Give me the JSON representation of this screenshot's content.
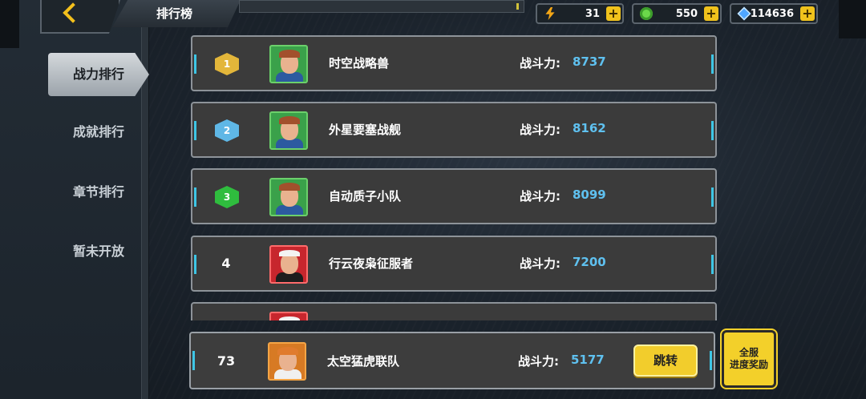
{
  "header": {
    "title": "排行榜"
  },
  "resources": [
    {
      "icon": "energy-bolt-icon",
      "value": "31"
    },
    {
      "icon": "green-gem-icon",
      "value": "550"
    },
    {
      "icon": "diamond-icon",
      "value": "114636"
    }
  ],
  "tabs": [
    "战力排行",
    "成就排行",
    "章节排行",
    "暂未开放"
  ],
  "power_label": "战斗力:",
  "rows": [
    {
      "rank": "1",
      "name": "时空战略兽",
      "power": "8737"
    },
    {
      "rank": "2",
      "name": "外星要塞战舰",
      "power": "8162"
    },
    {
      "rank": "3",
      "name": "自动质子小队",
      "power": "8099"
    },
    {
      "rank": "4",
      "name": "行云夜枭征服者",
      "power": "7200"
    }
  ],
  "my_rank": {
    "rank": "73",
    "name": "太空猛虎联队",
    "power": "5177",
    "jump_label": "跳转"
  },
  "reward_button": {
    "line1": "全服",
    "line2": "进度奖励"
  }
}
